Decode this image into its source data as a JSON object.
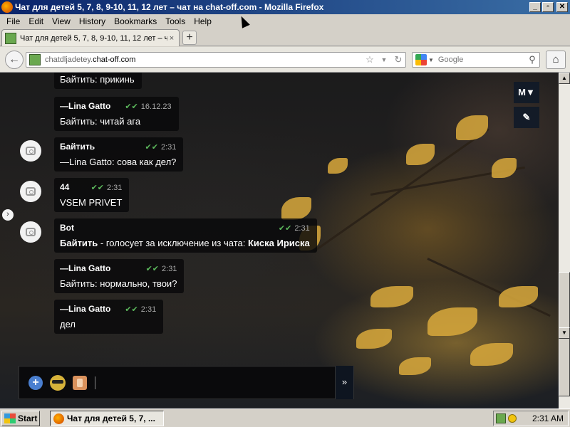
{
  "window": {
    "title": "Чат для детей 5, 7, 8, 9-10, 11, 12 лет – чат на chat-off.com - Mozilla Firefox",
    "minimize": "_",
    "maximize": "▫",
    "close": "✕"
  },
  "menu": [
    "File",
    "Edit",
    "View",
    "History",
    "Bookmarks",
    "Tools",
    "Help"
  ],
  "tab": {
    "label": "Чат для детей 5, 7, 8, 9-10, 11, 12 лет – чат...",
    "close": "×",
    "new": "+"
  },
  "nav": {
    "url_prefix": "chatdljadetey.",
    "url_domain": "chat-off.com",
    "search_placeholder": "Google"
  },
  "messages": [
    {
      "author": "",
      "time": "",
      "text": "Байтить: прикинь",
      "avatar": false
    },
    {
      "author": "—Lina Gatto",
      "time": "16.12.23",
      "text": "Байтить: читай ага",
      "avatar": false
    },
    {
      "author": "Байтить",
      "time": "2:31",
      "text": "—Lina Gatto: сова как дел?",
      "avatar": true
    },
    {
      "author": "44",
      "time": "2:31",
      "text": "VSEM PRIVET",
      "avatar": true
    },
    {
      "author": "Bot",
      "time": "2:31",
      "text_bold1": "Байтить",
      "text_mid": " - голосует за исключение из чата: ",
      "text_bold2": "Киска Ириска",
      "avatar": true
    },
    {
      "author": "—Lina Gatto",
      "time": "2:31",
      "text": "Байтить: нормально, твои?",
      "avatar": false
    },
    {
      "author": "—Lina Gatto",
      "time": "2:31",
      "text": "дел",
      "avatar": false
    }
  ],
  "side_buttons": {
    "menu": "M▼",
    "eraser": "✎"
  },
  "composer": {
    "send": "»",
    "value": ""
  },
  "taskbar": {
    "start": "Start",
    "task": "Чат для детей 5, 7, ...",
    "clock": "2:31 AM"
  }
}
